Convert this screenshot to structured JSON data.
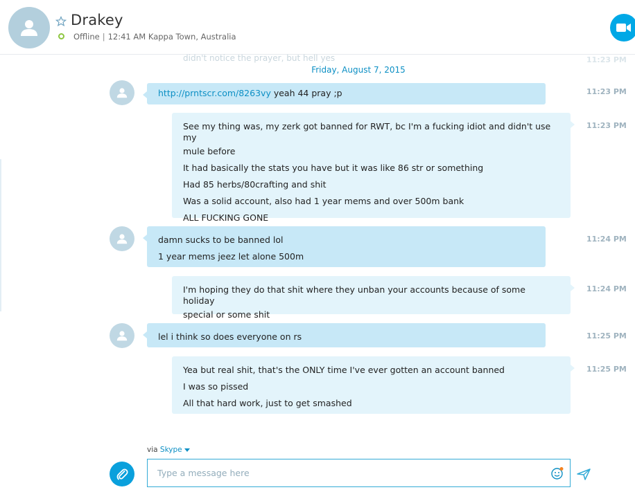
{
  "contact": {
    "name": "Drakey",
    "status": "Offline",
    "local_time": "12:41 AM Kappa Town, Australia",
    "separator": "|"
  },
  "history": {
    "faded_preview": "didn't notice the prayer, but hell yes",
    "date_separator": "Friday, August 7, 2015"
  },
  "messages": [
    {
      "sender": "Drakey",
      "time": "11:23 PM",
      "link": "http://prntscr.com/8263vy",
      "lines": [
        "yeah 44 pray ;p"
      ]
    },
    {
      "sender": "me",
      "time": "11:23 PM",
      "lines": [
        "See my thing was, my zerk got banned for RWT, bc I'm a fucking idiot and didn't use my",
        "mule before",
        "It had basically the stats you have but it was like 86 str or something",
        "Had 85 herbs/80crafting and shit",
        "Was a solid account, also had 1 year mems and over 500m bank",
        "ALL FUCKING GONE"
      ]
    },
    {
      "sender": "Drakey",
      "time": "11:24 PM",
      "lines": [
        "damn sucks to be banned lol",
        "1 year mems jeez let alone 500m"
      ]
    },
    {
      "sender": "me",
      "time": "11:24 PM",
      "lines": [
        "I'm hoping they do that shit where they unban your accounts because of some holiday",
        "special or some shit"
      ]
    },
    {
      "sender": "Drakey",
      "time": "11:25 PM",
      "lines": [
        "lel i think so does everyone on rs"
      ]
    },
    {
      "sender": "me",
      "time": "11:25 PM",
      "lines": [
        "Yea but real shit, that's the ONLY time I've ever gotten an account banned",
        "I was so pissed",
        "All that hard work, just to get smashed"
      ]
    }
  ],
  "composer": {
    "via_label": "via",
    "via_service": "Skype",
    "placeholder": "Type a message here"
  },
  "icons": {
    "avatar": "person-icon",
    "favorite": "star-icon",
    "video": "video-camera-icon",
    "attach": "paperclip-icon",
    "emoji": "smiley-icon",
    "send": "send-arrow-icon"
  },
  "colors": {
    "accent": "#00a8e6",
    "incoming_bubble": "#c7e8f7",
    "outgoing_bubble": "#e3f4fb",
    "status_offline": "#8dc63f"
  }
}
